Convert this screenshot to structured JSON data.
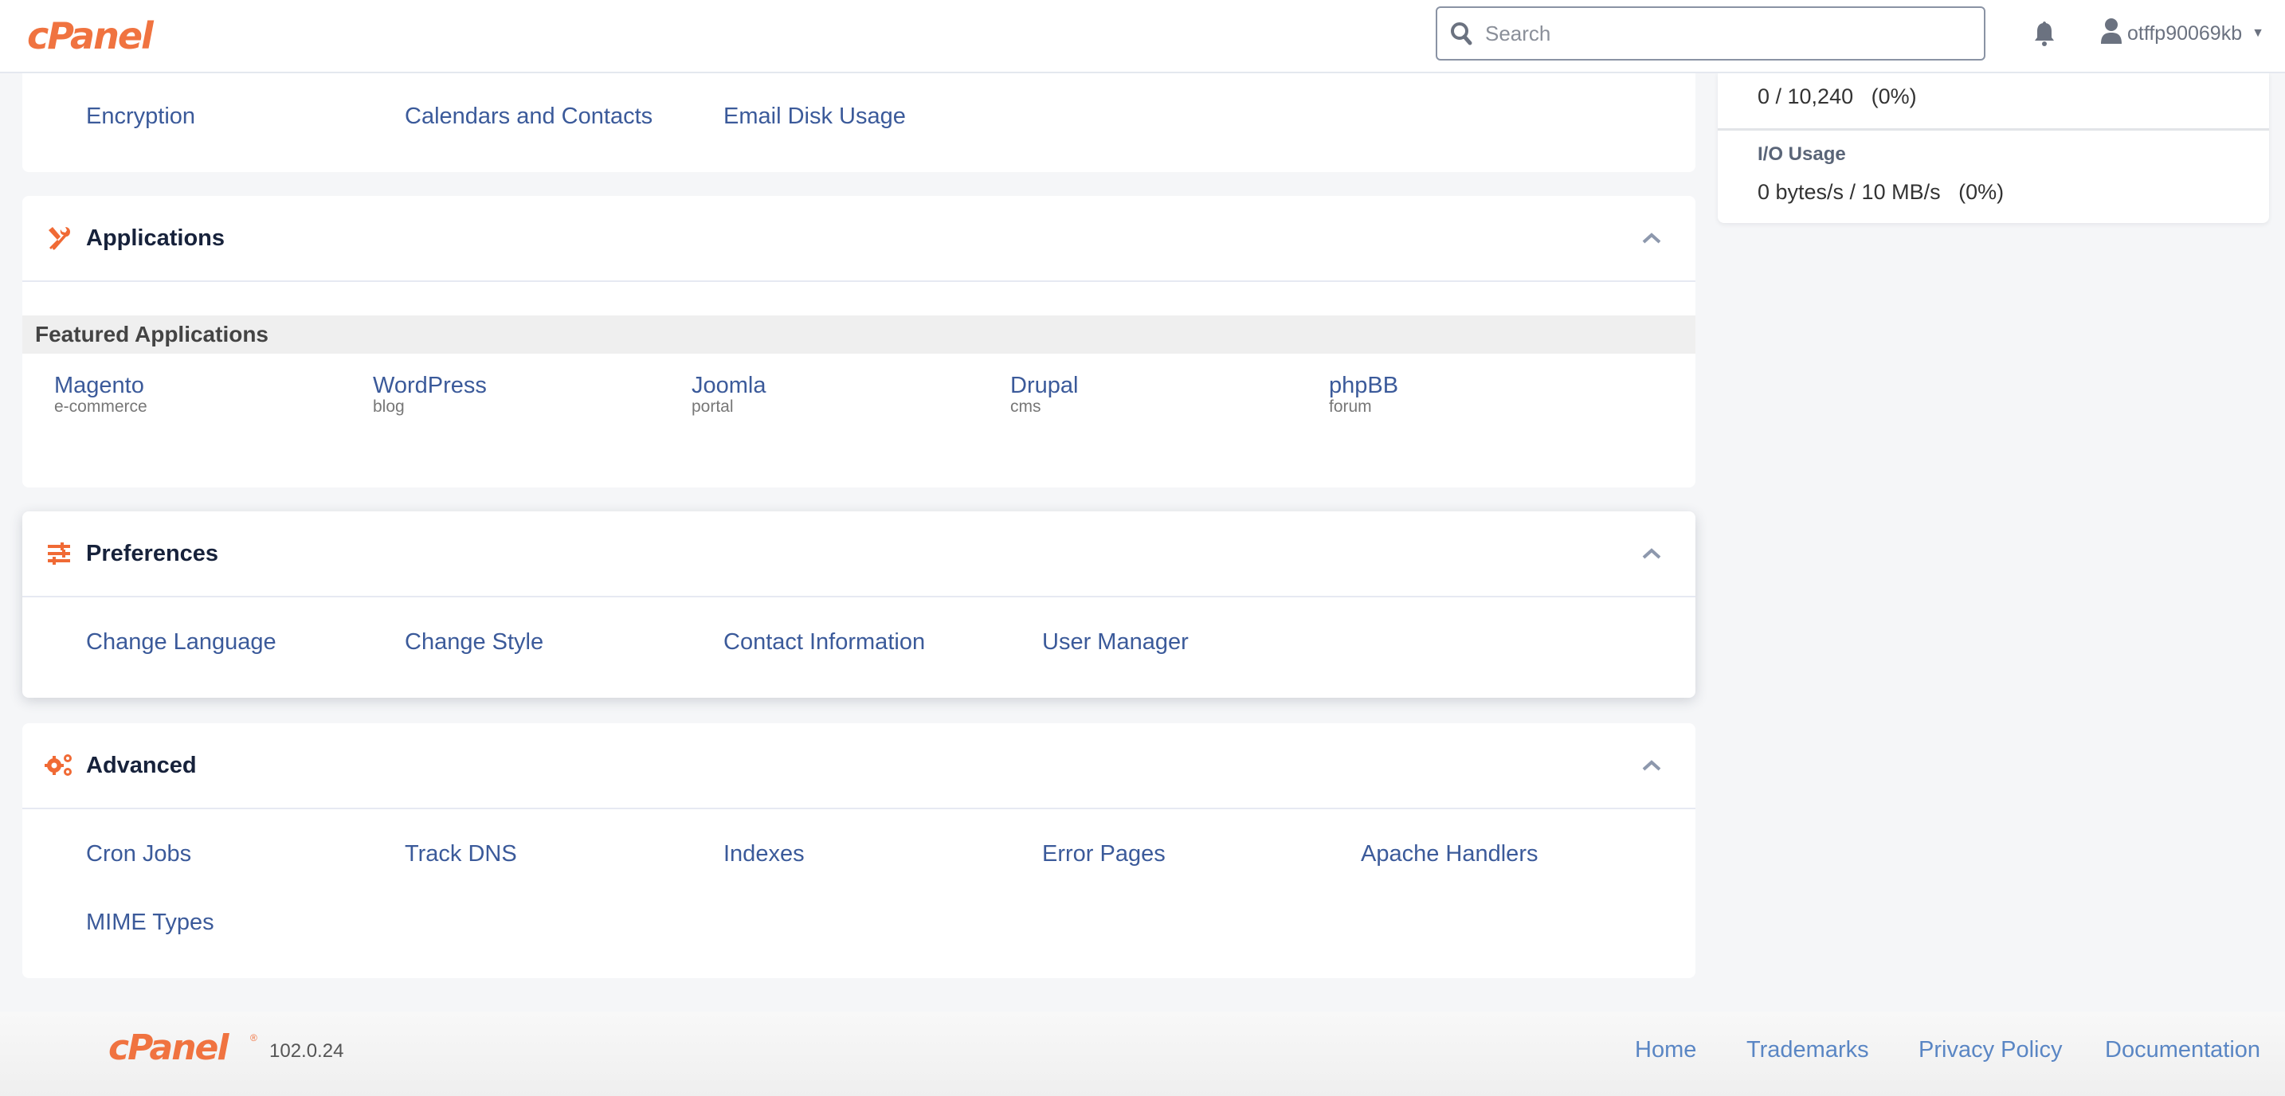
{
  "header": {
    "logo_text": "cPanel",
    "search_placeholder": "Search",
    "search_value": "",
    "username": "otffp90069kb",
    "icons": {
      "search": "search-icon",
      "notifications": "bell-icon",
      "user": "user-icon",
      "caret": "caret-down-icon"
    }
  },
  "email_section_tail": {
    "links": [
      "Encryption",
      "Calendars and Contacts",
      "Email Disk Usage"
    ]
  },
  "stats": {
    "prev_value": "0 / 10,240   (0%)",
    "io_label": "I/O Usage",
    "io_value": "0 bytes/s / 10 MB/s   (0%)"
  },
  "applications": {
    "title": "Applications",
    "icon": "wrench-screwdriver-icon",
    "featured_label": "Featured Applications",
    "apps": [
      {
        "name": "Magento",
        "type": "e-commerce"
      },
      {
        "name": "WordPress",
        "type": "blog"
      },
      {
        "name": "Joomla",
        "type": "portal"
      },
      {
        "name": "Drupal",
        "type": "cms"
      },
      {
        "name": "phpBB",
        "type": "forum"
      }
    ]
  },
  "preferences": {
    "title": "Preferences",
    "icon": "sliders-icon",
    "links": [
      "Change Language",
      "Change Style",
      "Contact Information",
      "User Manager"
    ]
  },
  "advanced": {
    "title": "Advanced",
    "icon": "gears-icon",
    "links": [
      "Cron Jobs",
      "Track DNS",
      "Indexes",
      "Error Pages",
      "Apache Handlers",
      "MIME Types"
    ]
  },
  "footer": {
    "logo_text": "cPanel",
    "registered": "®",
    "version": "102.0.24",
    "links": [
      "Home",
      "Trademarks",
      "Privacy Policy",
      "Documentation"
    ]
  },
  "colors": {
    "brand_orange": "#f07340",
    "link_blue": "#3b5a9a",
    "footer_link_blue": "#5a86c4",
    "heading_dark": "#17223b"
  }
}
